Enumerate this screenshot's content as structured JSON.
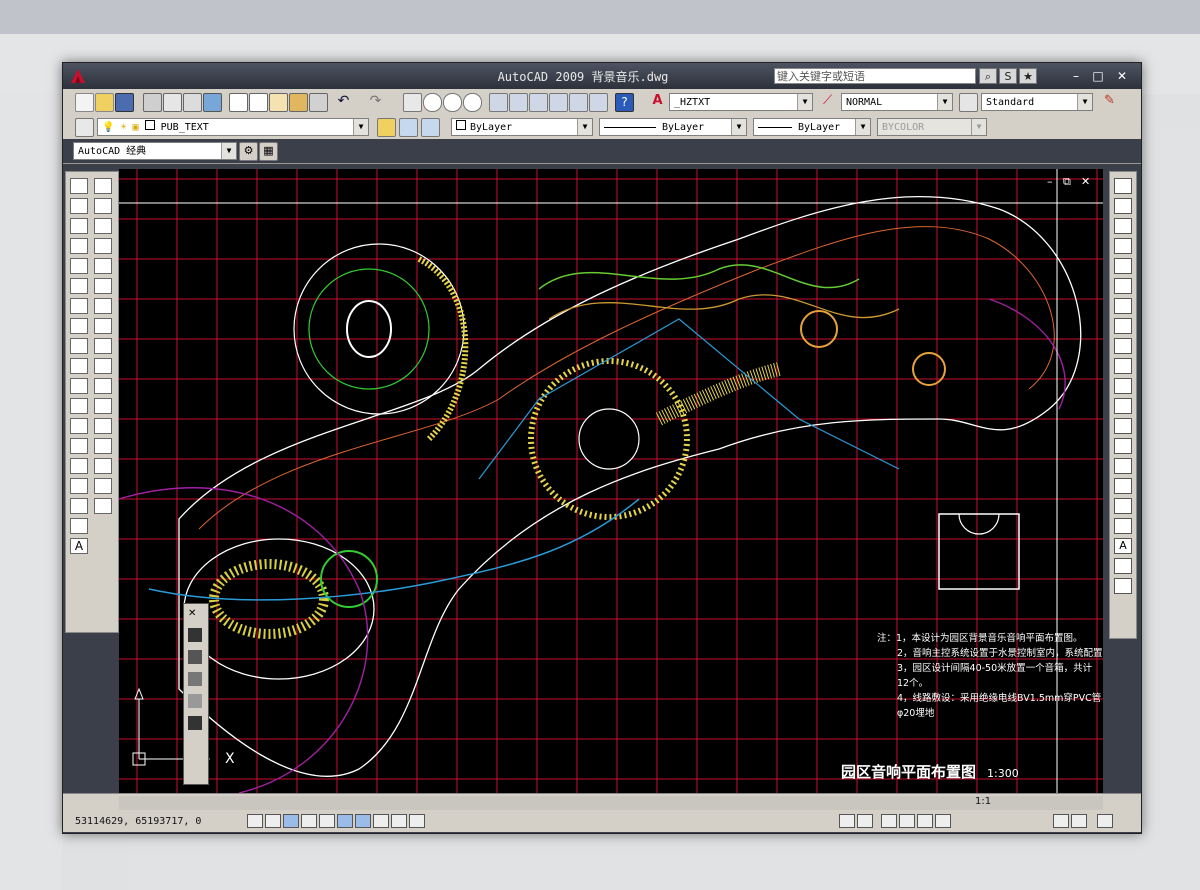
{
  "window": {
    "title": "AutoCAD 2009 背景音乐.dwg",
    "search_placeholder": "键入关键字或短语"
  },
  "toolbar": {
    "text_style": "_HZTXT",
    "dim_style": "NORMAL",
    "table_style": "Standard",
    "layer": "PUB_TEXT",
    "color": "ByLayer",
    "linetype": "ByLayer",
    "lineweight": "ByLayer",
    "plot_style": "BYCOLOR",
    "workspace": "AutoCAD 经典"
  },
  "drawing": {
    "notes": [
      "注：1，本设计为园区背景音乐音响平面布置图。",
      "2，音响主控系统设置于水景控制室内，系统配置",
      "3，园区设计间隔40-50米放置一个音箱，共计12个。",
      "4，线路敷设：采用绝缘电线BV1.5mm穿PVC管φ20埋地"
    ],
    "plan_title": "园区音响平面布置图",
    "scale": "1:300",
    "ucs_label": "X"
  },
  "status": {
    "coordinates": "53114629, 65193717, 0",
    "annotation_scale": "1:1"
  },
  "colors": {
    "grid": "#c8102e",
    "background": "#000000",
    "chrome": "#d4d0c8"
  }
}
